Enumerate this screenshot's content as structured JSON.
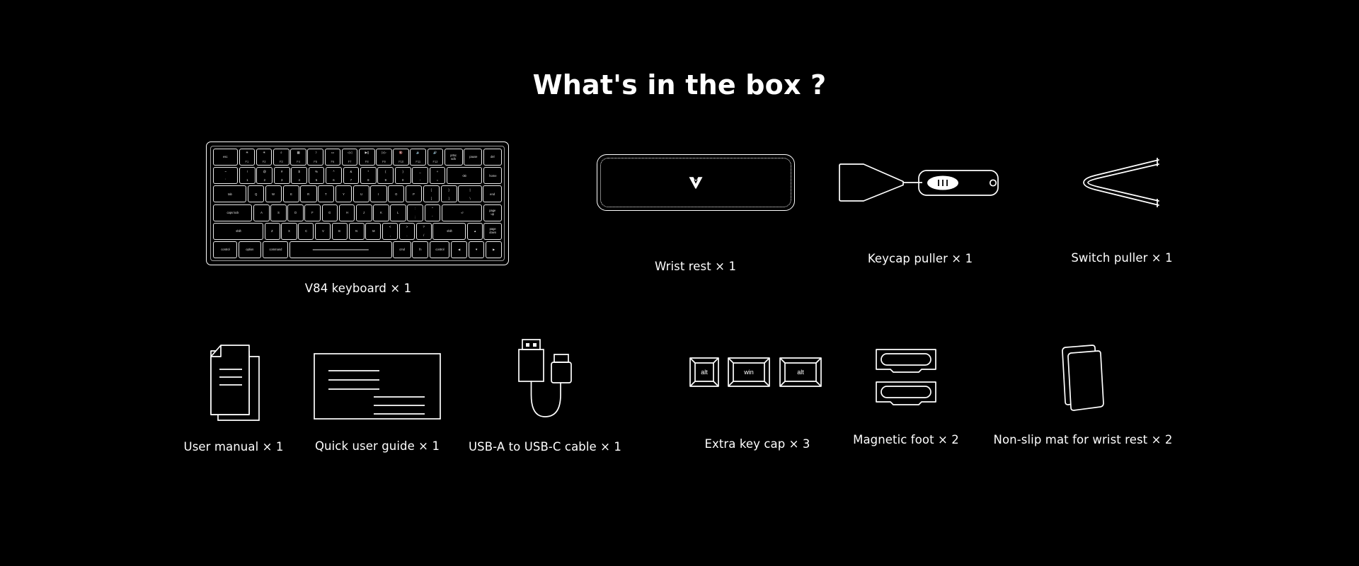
{
  "page": {
    "background": "#000000",
    "foreground": "#ffffff",
    "title": "What's in the box ?"
  },
  "row1": [
    {
      "key": "keyboard",
      "label": "V84 keyboard × 1",
      "icon": "keyboard-icon"
    },
    {
      "key": "wrist_rest",
      "label": "Wrist rest × 1",
      "icon": "wrist-rest-icon"
    },
    {
      "key": "keycap_puller",
      "label": "Keycap puller × 1",
      "icon": "keycap-puller-icon"
    },
    {
      "key": "switch_puller",
      "label": "Switch puller × 1",
      "icon": "switch-puller-icon"
    }
  ],
  "row2": [
    {
      "key": "user_manual",
      "label": "User manual × 1",
      "icon": "documents-icon"
    },
    {
      "key": "quick_guide",
      "label": "Quick user guide × 1",
      "icon": "guide-sheet-icon"
    },
    {
      "key": "usb_cable",
      "label": "USB-A to USB-C cable × 1",
      "icon": "usb-cable-icon"
    },
    {
      "key": "extra_keycaps",
      "label": "Extra key cap × 3",
      "icon": "keycaps-icon"
    },
    {
      "key": "magnetic_foot",
      "label": "Magnetic foot × 2",
      "icon": "magnetic-foot-icon"
    },
    {
      "key": "non_slip_mat",
      "label": "Non-slip mat for wrist rest × 2",
      "icon": "non-slip-mat-icon"
    }
  ],
  "keycaps": {
    "cap1": "alt",
    "cap2": "win",
    "cap3": "alt"
  },
  "keyboard": {
    "rows": [
      [
        {
          "t": "esc",
          "w": 1.55
        },
        {
          "top": "☀",
          "bot": "F1",
          "w": 1
        },
        {
          "top": "☀",
          "bot": "F2",
          "w": 1
        },
        {
          "top": "⌕",
          "bot": "F3",
          "w": 1
        },
        {
          "top": "▦",
          "bot": "F4",
          "w": 1
        },
        {
          "top": "☽",
          "bot": "F5",
          "w": 1
        },
        {
          "top": "▭",
          "bot": "F6",
          "w": 1
        },
        {
          "top": "◁◁",
          "bot": "F7",
          "w": 1
        },
        {
          "top": "▶||",
          "bot": "F8",
          "w": 1
        },
        {
          "top": "▷▷",
          "bot": "F9",
          "w": 1
        },
        {
          "top": "🔇",
          "bot": "F10",
          "w": 1
        },
        {
          "top": "🔉",
          "bot": "F11",
          "w": 1
        },
        {
          "top": "🔊",
          "bot": "F12",
          "w": 1
        },
        {
          "t": "prtsc\nsclk",
          "w": 1.15
        },
        {
          "t": "pause",
          "w": 1.15
        },
        {
          "t": "del",
          "w": 1.15
        }
      ],
      [
        {
          "t": "~\n`",
          "w": 1.55
        },
        {
          "t": "!\n1",
          "w": 1
        },
        {
          "t": "@\n2",
          "w": 1
        },
        {
          "t": "#\n3",
          "w": 1
        },
        {
          "t": "$\n4",
          "w": 1
        },
        {
          "t": "%\n5",
          "w": 1
        },
        {
          "t": "^\n6",
          "w": 1
        },
        {
          "t": "&\n7",
          "w": 1
        },
        {
          "t": "*\n8",
          "w": 1
        },
        {
          "t": "(\n9",
          "w": 1
        },
        {
          "t": ")\n0",
          "w": 1
        },
        {
          "t": "_\n-",
          "w": 1
        },
        {
          "t": "+\n=",
          "w": 1
        },
        {
          "t": "⌫",
          "w": 2.2
        },
        {
          "t": "home",
          "w": 1.15
        }
      ],
      [
        {
          "t": "tab",
          "w": 2.05
        },
        {
          "t": "Q",
          "w": 1
        },
        {
          "t": "W",
          "w": 1
        },
        {
          "t": "E",
          "w": 1
        },
        {
          "t": "R",
          "w": 1
        },
        {
          "t": "T",
          "w": 1
        },
        {
          "t": "Y",
          "w": 1
        },
        {
          "t": "U",
          "w": 1
        },
        {
          "t": "I",
          "w": 1
        },
        {
          "t": "O",
          "w": 1
        },
        {
          "t": "P",
          "w": 1
        },
        {
          "t": "{\n[",
          "w": 1
        },
        {
          "t": "}\n]",
          "w": 1
        },
        {
          "t": "|\n\\",
          "w": 1.45
        },
        {
          "t": "end",
          "w": 1.15
        }
      ],
      [
        {
          "t": "caps lock",
          "w": 2.45
        },
        {
          "t": "A",
          "w": 1
        },
        {
          "t": "S",
          "w": 1
        },
        {
          "t": "D",
          "w": 1
        },
        {
          "t": "F",
          "w": 1
        },
        {
          "t": "G",
          "w": 1
        },
        {
          "t": "H",
          "w": 1
        },
        {
          "t": "J",
          "w": 1
        },
        {
          "t": "K",
          "w": 1
        },
        {
          "t": "L",
          "w": 1
        },
        {
          "t": ":\n;",
          "w": 1
        },
        {
          "t": "\"\n'",
          "w": 1
        },
        {
          "t": "⏎",
          "w": 2.55
        },
        {
          "t": "page\nup",
          "w": 1.15
        }
      ],
      [
        {
          "t": "shift",
          "w": 3.2
        },
        {
          "t": "Z",
          "w": 1
        },
        {
          "t": "X",
          "w": 1
        },
        {
          "t": "C",
          "w": 1
        },
        {
          "t": "V",
          "w": 1
        },
        {
          "t": "B",
          "w": 1
        },
        {
          "t": "N",
          "w": 1
        },
        {
          "t": "M",
          "w": 1
        },
        {
          "t": "<\n,",
          "w": 1
        },
        {
          "t": ">\n.",
          "w": 1
        },
        {
          "t": "?\n/",
          "w": 1
        },
        {
          "t": "shift",
          "w": 2.1
        },
        {
          "t": "▲",
          "w": 1
        },
        {
          "t": "page\ndown",
          "w": 1.15
        }
      ],
      [
        {
          "t": "control",
          "w": 1.5
        },
        {
          "t": "option",
          "w": 1.4
        },
        {
          "t": "command",
          "w": 1.6
        },
        {
          "t": "",
          "w": 6.3,
          "space": true
        },
        {
          "t": "cmd",
          "w": 1.1
        },
        {
          "t": "fn",
          "w": 1
        },
        {
          "t": "control",
          "w": 1.25
        },
        {
          "t": "◀",
          "w": 1
        },
        {
          "t": "▼",
          "w": 1
        },
        {
          "t": "▶",
          "w": 1
        }
      ]
    ]
  }
}
